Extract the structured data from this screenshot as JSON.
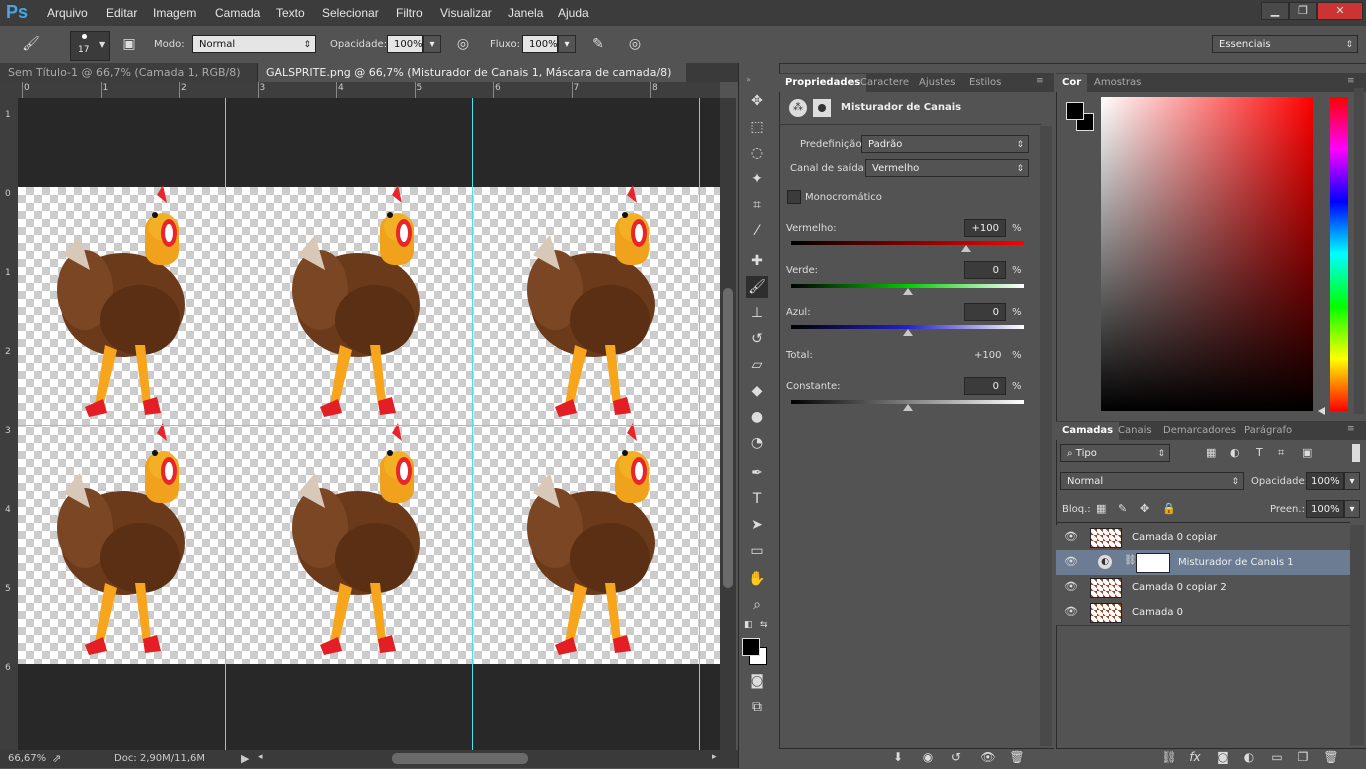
{
  "app": {
    "logo": "Ps"
  },
  "menu": [
    "Arquivo",
    "Editar",
    "Imagem",
    "Camada",
    "Texto",
    "Selecionar",
    "Filtro",
    "Visualizar",
    "Janela",
    "Ajuda"
  ],
  "window": {
    "minimize": "▁",
    "restore": "❐",
    "close": "✕"
  },
  "options": {
    "brush_size": "17",
    "mode_label": "Modo:",
    "mode_value": "Normal",
    "opacity_label": "Opacidade:",
    "opacity_value": "100%",
    "flow_label": "Fluxo:",
    "flow_value": "100%",
    "workspace": "Essenciais"
  },
  "tabs": [
    {
      "label": "Sem Título-1 @ 66,7% (Camada 1, RGB/8) *",
      "close": "×"
    },
    {
      "label": "GALSPRITE.png @ 66,7% (Misturador de Canais 1, Máscara de camada/8) *",
      "close": "×"
    }
  ],
  "ruler": {
    "top": [
      "0",
      "1",
      "2",
      "3",
      "4",
      "5",
      "6",
      "7",
      "8"
    ],
    "left": [
      "1",
      "0",
      "1",
      "2",
      "3",
      "4",
      "5",
      "6"
    ]
  },
  "status": {
    "zoom": "66,67%",
    "doc": "Doc: 2,90M/11,6M"
  },
  "properties": {
    "tabs": [
      "Propriedades",
      "Caractere",
      "Ajustes",
      "Estilos"
    ],
    "title": "Misturador de Canais",
    "preset_label": "Predefinição:",
    "preset_value": "Padrão",
    "output_label": "Canal de saída:",
    "output_value": "Vermelho",
    "mono_label": "Monocromático",
    "red_label": "Vermelho:",
    "red_value": "+100",
    "green_label": "Verde:",
    "green_value": "0",
    "blue_label": "Azul:",
    "blue_value": "0",
    "total_label": "Total:",
    "total_value": "+100",
    "constant_label": "Constante:",
    "constant_value": "0",
    "percent": "%",
    "red_level": 1.0,
    "green_level": 0.5,
    "blue_level": 0.5,
    "constant_level": 0.5
  },
  "color_panel": {
    "tabs": [
      "Cor",
      "Amostras"
    ]
  },
  "layers_panel": {
    "tabs": [
      "Camadas",
      "Canais",
      "Demarcadores",
      "Parágrafo"
    ],
    "filter": "Tipo",
    "blend": "Normal",
    "opacity_label": "Opacidade:",
    "opacity_value": "100%",
    "lock_label": "Bloq.:",
    "fill_label": "Preen.:",
    "fill_value": "100%",
    "layers": [
      {
        "name": "Camada 0 copiar"
      },
      {
        "name": "Misturador de Canais 1"
      },
      {
        "name": "Camada 0 copiar 2"
      },
      {
        "name": "Camada 0"
      }
    ]
  },
  "colors": {
    "accent": "#45a6e8",
    "guide": "#4de0e8",
    "selected_layer": "#6b7c93"
  }
}
